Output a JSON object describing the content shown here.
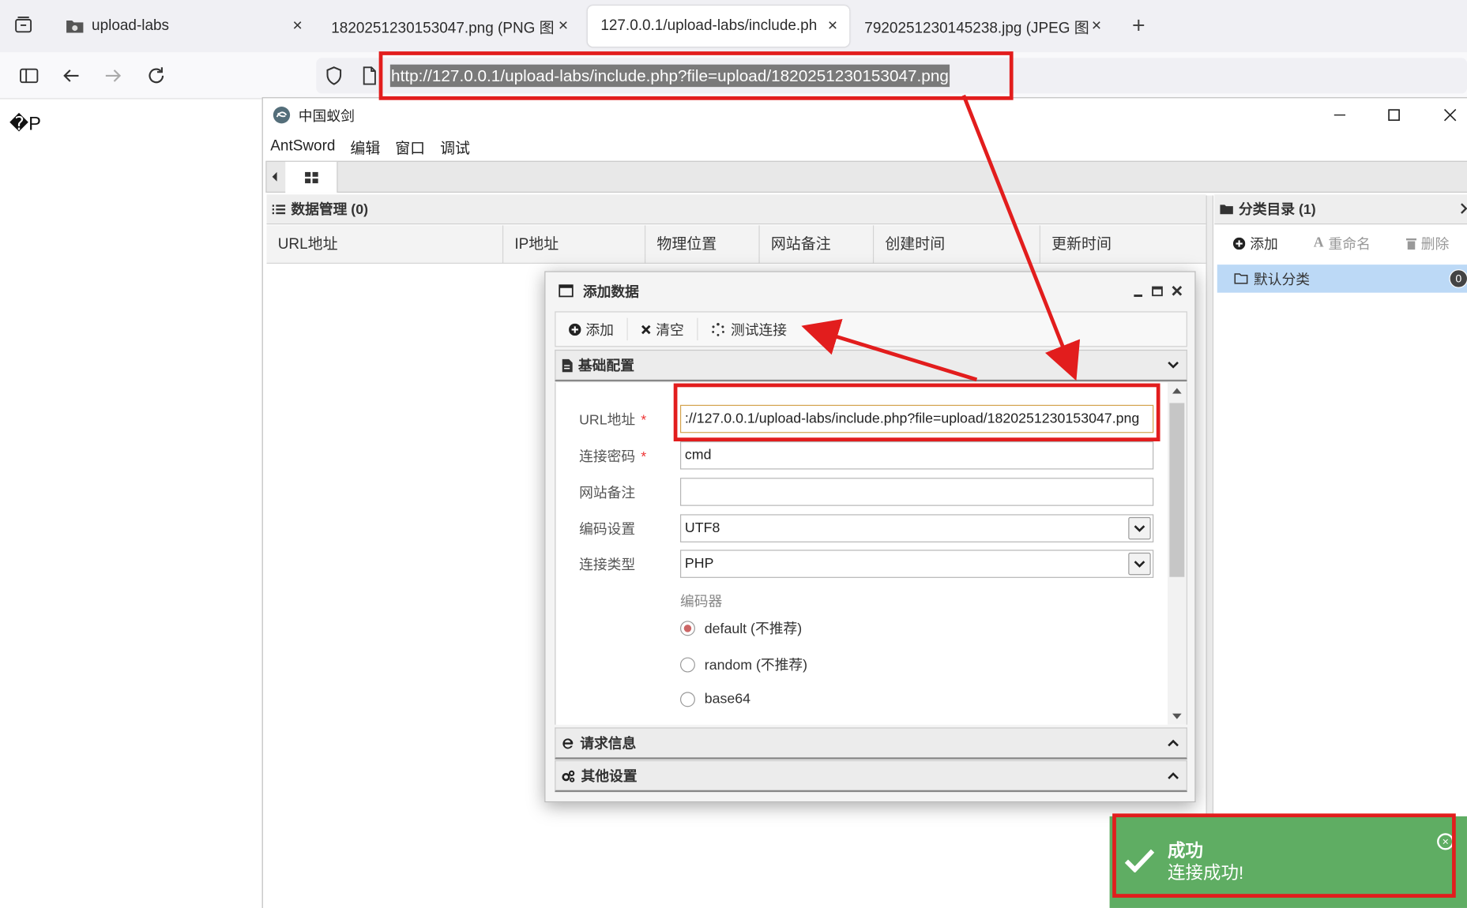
{
  "browser": {
    "tabs": [
      {
        "label": "upload-labs",
        "close": "×"
      },
      {
        "label": "1820251230153047.png (PNG 图像",
        "close": "×"
      },
      {
        "label": "127.0.0.1/upload-labs/include.ph",
        "close": "×"
      },
      {
        "label": "7920251230145238.jpg (JPEG 图像",
        "close": "×"
      }
    ],
    "new_tab": "+",
    "address": "http://127.0.0.1/upload-labs/include.php?file=upload/1820251230153047.png"
  },
  "page": {
    "content": "�P"
  },
  "antsword": {
    "title": "中国蚁剑",
    "menu": [
      "AntSword",
      "编辑",
      "窗口",
      "调试"
    ],
    "data_panel": {
      "title": "数据管理 (0)"
    },
    "columns": [
      "URL地址",
      "IP地址",
      "物理位置",
      "网站备注",
      "创建时间",
      "更新时间"
    ],
    "category_panel": {
      "title": "分类目录 (1)",
      "add": "添加",
      "rename": "重命名",
      "delete": "删除",
      "items": [
        {
          "label": "默认分类",
          "count": "0"
        }
      ]
    }
  },
  "dialog": {
    "title": "添加数据",
    "toolbar": {
      "add": "添加",
      "clear": "清空",
      "test": "测试连接"
    },
    "section_basic": "基础配置",
    "section_request": "请求信息",
    "section_other": "其他设置",
    "fields": {
      "url_label": "URL地址",
      "url_value": "://127.0.0.1/upload-labs/include.php?file=upload/1820251230153047.png",
      "password_label": "连接密码",
      "password_value": "cmd",
      "note_label": "网站备注",
      "note_value": "",
      "encoding_label": "编码设置",
      "encoding_value": "UTF8",
      "type_label": "连接类型",
      "type_value": "PHP",
      "required_mark": "*"
    },
    "encoder": {
      "label": "编码器",
      "options": [
        "default (不推荐)",
        "random (不推荐)",
        "base64"
      ],
      "selected": "default (不推荐)"
    }
  },
  "toast": {
    "title": "成功",
    "message": "连接成功!",
    "close": "×"
  },
  "colors": {
    "annotation": "#e21d1d",
    "toast": "#5fad63",
    "selection": "#bcd9f6"
  }
}
